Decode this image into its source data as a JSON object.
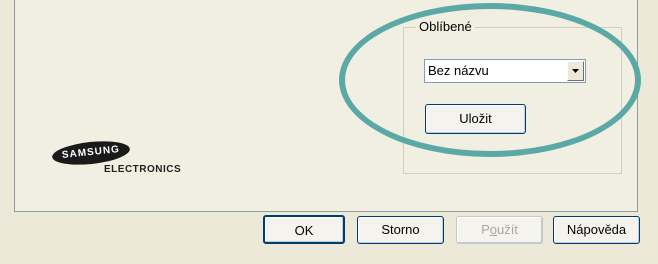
{
  "favorites": {
    "legend": "Oblíbené",
    "selected": "Bez názvu",
    "save_label": "Uložit"
  },
  "logo": {
    "brand": "SAMSUNG",
    "sub": "ELECTRONICS"
  },
  "dialog_buttons": {
    "ok": "OK",
    "cancel": "Storno",
    "apply_pre": "P",
    "apply_underline": "o",
    "apply_post": "užít",
    "help": "Nápověda"
  },
  "colors": {
    "highlight": "#5ba9a6",
    "panel": "#f1efe2",
    "dialog": "#ece9d8"
  }
}
